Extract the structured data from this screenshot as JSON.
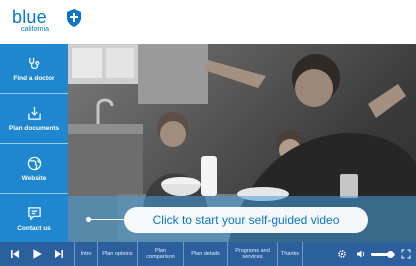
{
  "brand": {
    "name": "blue",
    "region": "california"
  },
  "sidebar": {
    "items": [
      {
        "label": "Find a doctor",
        "icon": "stethoscope-icon"
      },
      {
        "label": "Plan documents",
        "icon": "download-icon"
      },
      {
        "label": "Website",
        "icon": "globe-icon"
      },
      {
        "label": "Contact us",
        "icon": "chat-icon"
      }
    ]
  },
  "video": {
    "cta": "Click to start your self-guided video"
  },
  "controls": {
    "chapters": [
      "Intro",
      "Plan options",
      "Plan comparison",
      "Plan details",
      "Programs and services",
      "Thanks"
    ],
    "volume_level": 0.8
  },
  "colors": {
    "brand_blue": "#0c75c4",
    "sidebar": "#1e87cf",
    "control_bar": "#2b5f9e"
  }
}
